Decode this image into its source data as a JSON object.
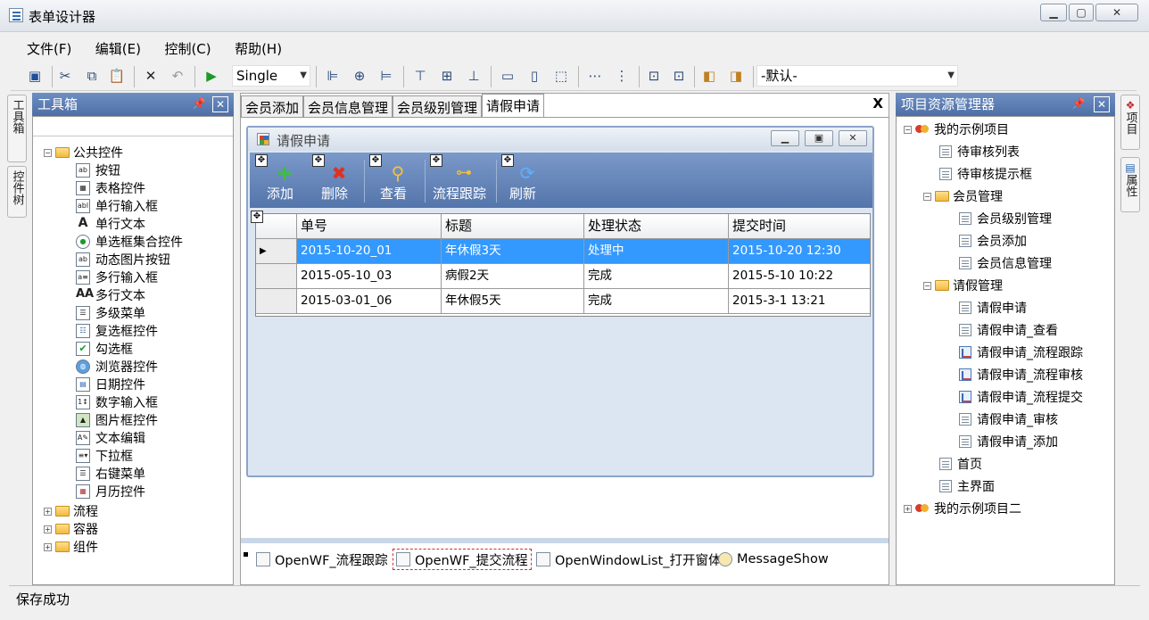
{
  "window": {
    "title": "表单设计器"
  },
  "menu": [
    "文件(F)",
    "编辑(E)",
    "控制(C)",
    "帮助(H)"
  ],
  "toolbar": {
    "mode_value": "Single",
    "style_value": "-默认-"
  },
  "left_tabs": [
    "工具箱",
    "控件树"
  ],
  "right_tabs": [
    "项目",
    "属性"
  ],
  "toolbox": {
    "title": "工具箱",
    "group_public": "公共控件",
    "controls": [
      "按钮",
      "表格控件",
      "单行输入框",
      "单行文本",
      "单选框集合控件",
      "动态图片按钮",
      "多行输入框",
      "多行文本",
      "多级菜单",
      "复选框控件",
      "勾选框",
      "浏览器控件",
      "日期控件",
      "数字输入框",
      "图片框控件",
      "文本编辑",
      "下拉框",
      "右键菜单",
      "月历控件"
    ],
    "groups": [
      "流程",
      "容器",
      "组件"
    ]
  },
  "doc_tabs": [
    "会员添加",
    "会员信息管理",
    "会员级别管理",
    "请假申请"
  ],
  "form": {
    "title": "请假申请",
    "toolbar": [
      "添加",
      "删除",
      "查看",
      "流程跟踪",
      "刷新"
    ],
    "columns": [
      "单号",
      "标题",
      "处理状态",
      "提交时间"
    ],
    "rows": [
      [
        "2015-10-20_01",
        "年休假3天",
        "处理中",
        "2015-10-20 12:30"
      ],
      [
        "2015-05-10_03",
        "病假2天",
        "完成",
        "2015-5-10 10:22"
      ],
      [
        "2015-03-01_06",
        "年休假5天",
        "完成",
        "2015-3-1 13:21"
      ]
    ]
  },
  "methods": [
    "OpenWF_流程跟踪",
    "OpenWF_提交流程",
    "OpenWindowList_打开窗体",
    "MessageShow"
  ],
  "project": {
    "title": "项目资源管理器",
    "root1": "我的示例项目",
    "items": [
      "待审核列表",
      "待审核提示框"
    ],
    "member_group": "会员管理",
    "member_items": [
      "会员级别管理",
      "会员添加",
      "会员信息管理"
    ],
    "leave_group": "请假管理",
    "leave_items": [
      "请假申请",
      "请假申请_查看",
      "请假申请_流程跟踪",
      "请假申请_流程审核",
      "请假申请_流程提交",
      "请假申请_审核",
      "请假申请_添加"
    ],
    "tail_items": [
      "首页",
      "主界面"
    ],
    "root2": "我的示例项目二"
  },
  "status": "保存成功"
}
